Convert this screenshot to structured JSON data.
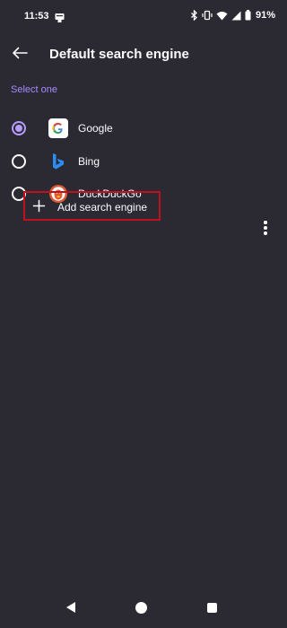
{
  "status_bar": {
    "time": "11:53",
    "battery": "91%",
    "icons": [
      "notification-icon",
      "bluetooth-icon",
      "vibrate-icon",
      "wifi-icon",
      "signal-icon",
      "battery-icon"
    ]
  },
  "toolbar": {
    "title": "Default search engine",
    "back_icon": "arrow-left-icon"
  },
  "section": {
    "label": "Select one"
  },
  "engines": [
    {
      "label": "Google",
      "selected": true,
      "icon": "google-icon"
    },
    {
      "label": "Bing",
      "selected": false,
      "icon": "bing-icon"
    },
    {
      "label": "DuckDuckGo",
      "selected": false,
      "icon": "duckduckgo-icon"
    }
  ],
  "add_engine": {
    "label": "Add search engine",
    "icon": "plus-icon"
  },
  "more_menu": {
    "icon": "more-vertical-icon"
  },
  "nav_bar": {
    "icons": [
      "nav-back-icon",
      "nav-home-icon",
      "nav-recents-icon"
    ]
  },
  "colors": {
    "background": "#2b2a33",
    "accent": "#a68bff",
    "radio_selected": "#b79cff",
    "highlight_border": "#c0101c",
    "text": "#fbfbfe"
  }
}
